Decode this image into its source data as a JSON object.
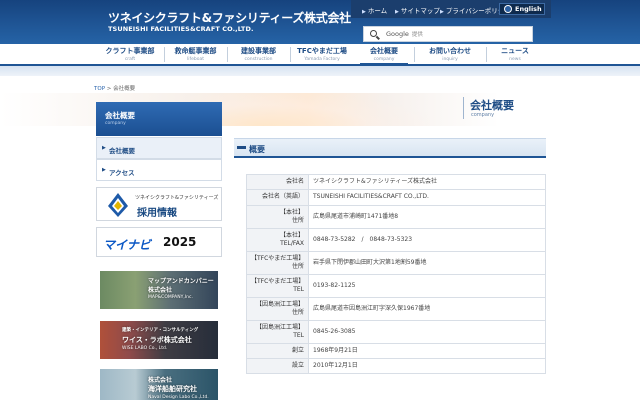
{
  "header": {
    "logo_jp": "ツネイシクラフト&ファシリティーズ株式会社",
    "logo_en": "TSUNEISHI FACILITIES&CRAFT CO.,LTD.",
    "util_links": [
      {
        "label": "ホーム"
      },
      {
        "label": "サイトマップ"
      },
      {
        "label": "プライバシーポリシー"
      }
    ],
    "english": "English",
    "search": {
      "label": "Google",
      "sublabel": "提供"
    }
  },
  "nav": [
    {
      "jp": "クラフト事業部",
      "en": "craft"
    },
    {
      "jp": "救命艇事業部",
      "en": "lifeboat"
    },
    {
      "jp": "建設事業部",
      "en": "construction"
    },
    {
      "jp": "TFCやまだ工場",
      "en": "Yamada Factory"
    },
    {
      "jp": "会社概要",
      "en": "company"
    },
    {
      "jp": "お問い合わせ",
      "en": "inquiry"
    },
    {
      "jp": "ニュース",
      "en": "news"
    }
  ],
  "breadcrumb": {
    "top": "TOP",
    "sep": ">",
    "current": "会社概要"
  },
  "hero": {
    "title": "会社概要",
    "sub": "company"
  },
  "sidebar": {
    "title": "会社概要",
    "title_en": "company",
    "items": [
      {
        "label": "会社概要"
      },
      {
        "label": "アクセス"
      }
    ],
    "banners": {
      "saiyo_small": "ツネイシクラフト&ファシリティーズ",
      "saiyo_big": "採用情報",
      "mynavi_logo": "マイナビ",
      "mynavi_year": "2025",
      "map_line1": "マップアンドカンパニー",
      "map_line2": "株式会社",
      "map_line3": "MAP&COMPANY,Inc.",
      "wise_line1": "建築・インテリア・コンサルティング",
      "wise_line2": "ワイス・ラボ株式会社",
      "wise_line3": "WISE LABO Co., Ltd.",
      "kaiyo_line1": "株式会社",
      "kaiyo_line2": "海洋船舶研究社",
      "kaiyo_line3": "Naval Design Labo Co.,Ltd."
    }
  },
  "section": {
    "title": "概要"
  },
  "table": [
    {
      "h": [
        "会社名"
      ],
      "v": "ツネイシクラフト&ファシリティーズ株式会社"
    },
    {
      "h": [
        "会社名（英語）"
      ],
      "v": "TSUNEISHI FACILITIES&CRAFT CO.,LTD."
    },
    {
      "h": [
        "【本社】",
        "住所"
      ],
      "v": "広島県尾道市浦崎町1471番地8"
    },
    {
      "h": [
        "【本社】",
        "TEL/FAX"
      ],
      "v": "0848-73-5282　/　0848-73-5323"
    },
    {
      "h": [
        "【TFCやまだ工場】",
        "住所"
      ],
      "v": "岩手県下閉伊郡山田町大沢第1地割59番地"
    },
    {
      "h": [
        "【TFCやまだ工場】",
        "TEL"
      ],
      "v": "0193-82-1125"
    },
    {
      "h": [
        "【因島洲江工場】",
        "住所"
      ],
      "v": "広島県尾道市因島洲江町字深久保1967番地"
    },
    {
      "h": [
        "【因島洲江工場】",
        "TEL"
      ],
      "v": "0845-26-3085"
    },
    {
      "h": [
        "創立"
      ],
      "v": "1968年9月21日"
    },
    {
      "h": [
        "設立"
      ],
      "v": "2010年12月1日"
    }
  ]
}
